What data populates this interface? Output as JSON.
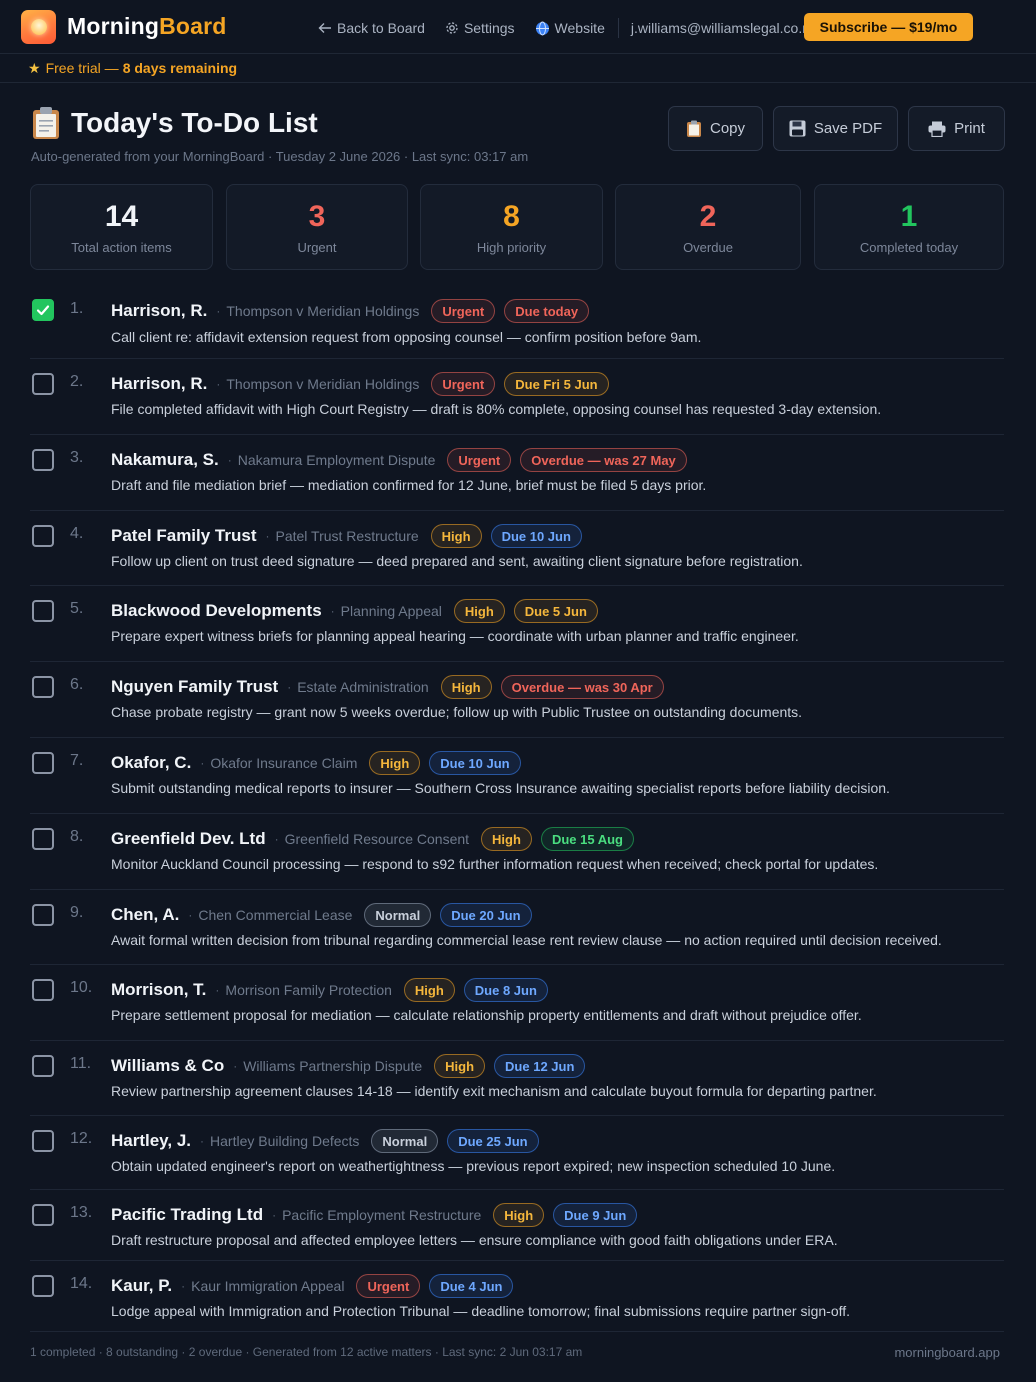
{
  "header": {
    "brand_part1": "Morning",
    "brand_part2": "Board",
    "nav": [
      {
        "label": "Back to Board",
        "icon": "arrow-left-icon"
      },
      {
        "label": "Settings",
        "icon": "gear-icon"
      },
      {
        "label": "Website",
        "icon": "globe-icon"
      }
    ],
    "email": "j.williams@williamslegal.co.nz",
    "subscribe_label": "Subscribe — $19/mo"
  },
  "trial": {
    "prefix": "Free trial —",
    "days": "8 days remaining"
  },
  "page": {
    "title": "Today's To-Do List",
    "subtitle": "Auto-generated from your MorningBoard · Tuesday 2 June 2026 · Last sync: 03:17 am"
  },
  "actions": {
    "copy": "Copy",
    "save_pdf": "Save PDF",
    "print": "Print"
  },
  "stats": [
    {
      "value": "14",
      "label": "Total action items",
      "color": "#f1f4f8"
    },
    {
      "value": "3",
      "label": "Urgent",
      "color": "#f0655a"
    },
    {
      "value": "8",
      "label": "High priority",
      "color": "#f5a524"
    },
    {
      "value": "2",
      "label": "Overdue",
      "color": "#f0655a"
    },
    {
      "value": "1",
      "label": "Completed today",
      "color": "#22c55e"
    }
  ],
  "tasks": [
    {
      "num": "1.",
      "client": "Harrison, R.",
      "matter": "Thompson v Meridian Holdings",
      "priority": "Urgent",
      "priority_kind": "urgent",
      "due": "Due today",
      "due_kind": "red",
      "desc": "Call client re: affidavit extension request from opposing counsel — confirm position before 9am.",
      "checked": true
    },
    {
      "num": "2.",
      "client": "Harrison, R.",
      "matter": "Thompson v Meridian Holdings",
      "priority": "Urgent",
      "priority_kind": "urgent",
      "due": "Due Fri 5 Jun",
      "due_kind": "amber",
      "desc": "File completed affidavit with High Court Registry — draft is 80% complete, opposing counsel has requested 3-day extension.",
      "checked": false
    },
    {
      "num": "3.",
      "client": "Nakamura, S.",
      "matter": "Nakamura Employment Dispute",
      "priority": "Urgent",
      "priority_kind": "urgent",
      "due": "Overdue — was 27 May",
      "due_kind": "red",
      "desc": "Draft and file mediation brief — mediation confirmed for 12 June, brief must be filed 5 days prior.",
      "checked": false
    },
    {
      "num": "4.",
      "client": "Patel Family Trust",
      "matter": "Patel Trust Restructure",
      "priority": "High",
      "priority_kind": "high",
      "due": "Due 10 Jun",
      "due_kind": "blue",
      "desc": "Follow up client on trust deed signature — deed prepared and sent, awaiting client signature before registration.",
      "checked": false
    },
    {
      "num": "5.",
      "client": "Blackwood Developments",
      "matter": "Planning Appeal",
      "priority": "High",
      "priority_kind": "high",
      "due": "Due 5 Jun",
      "due_kind": "amber",
      "desc": "Prepare expert witness briefs for planning appeal hearing — coordinate with urban planner and traffic engineer.",
      "checked": false
    },
    {
      "num": "6.",
      "client": "Nguyen Family Trust",
      "matter": "Estate Administration",
      "priority": "High",
      "priority_kind": "high",
      "due": "Overdue — was 30 Apr",
      "due_kind": "red",
      "desc": "Chase probate registry — grant now 5 weeks overdue; follow up with Public Trustee on outstanding documents.",
      "checked": false
    },
    {
      "num": "7.",
      "client": "Okafor, C.",
      "matter": "Okafor Insurance Claim",
      "priority": "High",
      "priority_kind": "high",
      "due": "Due 10 Jun",
      "due_kind": "blue",
      "desc": "Submit outstanding medical reports to insurer — Southern Cross Insurance awaiting specialist reports before liability decision.",
      "checked": false
    },
    {
      "num": "8.",
      "client": "Greenfield Dev. Ltd",
      "matter": "Greenfield Resource Consent",
      "priority": "High",
      "priority_kind": "high",
      "due": "Due 15 Aug",
      "due_kind": "green",
      "desc": "Monitor Auckland Council processing — respond to s92 further information request when received; check portal for updates.",
      "checked": false
    },
    {
      "num": "9.",
      "client": "Chen, A.",
      "matter": "Chen Commercial Lease",
      "priority": "Normal",
      "priority_kind": "normal",
      "due": "Due 20 Jun",
      "due_kind": "blue",
      "desc": "Await formal written decision from tribunal regarding commercial lease rent review clause — no action required until decision received.",
      "checked": false
    },
    {
      "num": "10.",
      "client": "Morrison, T.",
      "matter": "Morrison Family Protection",
      "priority": "High",
      "priority_kind": "high",
      "due": "Due 8 Jun",
      "due_kind": "blue",
      "desc": "Prepare settlement proposal for mediation — calculate relationship property entitlements and draft without prejudice offer.",
      "checked": false
    },
    {
      "num": "11.",
      "client": "Williams & Co",
      "matter": "Williams Partnership Dispute",
      "priority": "High",
      "priority_kind": "high",
      "due": "Due 12 Jun",
      "due_kind": "blue",
      "desc": "Review partnership agreement clauses 14-18 — identify exit mechanism and calculate buyout formula for departing partner.",
      "checked": false
    },
    {
      "num": "12.",
      "client": "Hartley, J.",
      "matter": "Hartley Building Defects",
      "priority": "Normal",
      "priority_kind": "normal",
      "due": "Due 25 Jun",
      "due_kind": "blue",
      "desc": "Obtain updated engineer's report on weathertightness — previous report expired; new inspection scheduled 10 June.",
      "checked": false
    },
    {
      "num": "13.",
      "client": "Pacific Trading Ltd",
      "matter": "Pacific Employment Restructure",
      "priority": "High",
      "priority_kind": "high",
      "due": "Due 9 Jun",
      "due_kind": "blue",
      "desc": "Draft restructure proposal and affected employee letters — ensure compliance with good faith obligations under ERA.",
      "checked": false
    },
    {
      "num": "14.",
      "client": "Kaur, P.",
      "matter": "Kaur Immigration Appeal",
      "priority": "Urgent",
      "priority_kind": "urgent",
      "due": "Due 4 Jun",
      "due_kind": "blue",
      "desc": "Lodge appeal with Immigration and Protection Tribunal — deadline tomorrow; final submissions require partner sign-off.",
      "checked": false
    }
  ],
  "footer": {
    "summary": "1 completed · 8 outstanding · 2 overdue · Generated from 12 active matters · Last sync: 2 Jun 03:17 am",
    "domain": "morningboard.app"
  }
}
